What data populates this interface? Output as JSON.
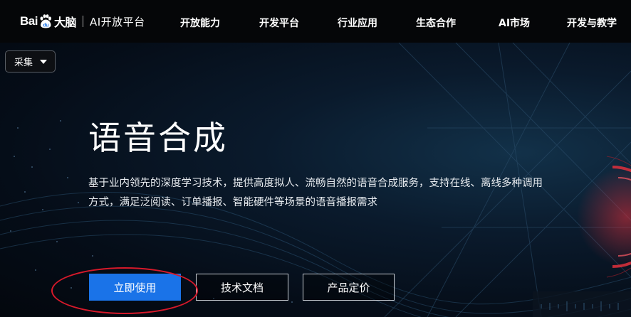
{
  "brand": {
    "logo_left": "Bai",
    "logo_paw_text": "du",
    "logo_cn": "大脑",
    "platform_name": "AI开放平台"
  },
  "nav": {
    "items": [
      {
        "label": "开放能力"
      },
      {
        "label": "开发平台"
      },
      {
        "label": "行业应用"
      },
      {
        "label": "生态合作"
      },
      {
        "label": "AI市场"
      },
      {
        "label": "开发与教学"
      }
    ]
  },
  "collect_button": {
    "label": "采集"
  },
  "hero": {
    "title": "语音合成",
    "description": "基于业内领先的深度学习技术，提供高度拟人、流畅自然的语音合成服务，支持在线、离线多种调用方式，满足泛阅读、订单播报、智能硬件等场景的语音播报需求",
    "buttons": {
      "primary": "立即使用",
      "docs": "技术文档",
      "pricing": "产品定价"
    }
  },
  "colors": {
    "nav_bg": "#050608",
    "primary": "#1a73e8",
    "annotation": "#d7192a",
    "accent_red": "#e0303c"
  },
  "icons": [
    "baidu-paw-icon",
    "caret-down-icon"
  ]
}
